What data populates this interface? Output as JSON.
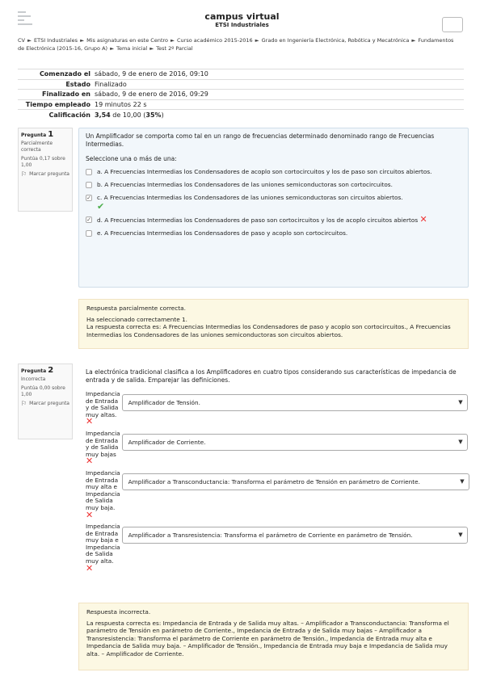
{
  "header": {
    "site_title": "campus virtual",
    "site_subtitle": "ETSI Industriales"
  },
  "breadcrumb": [
    "CV",
    "ETSI Industriales",
    "Mis asignaturas en este Centro",
    "Curso académico 2015-2016",
    "Grado en Ingeniería Electrónica, Robótica y Mecatrónica",
    "Fundamentos de Electrónica (2015-16, Grupo A)",
    "Tema inicial",
    "Test 2º Parcial"
  ],
  "summary": {
    "rows": [
      {
        "label": "Comenzado el",
        "value": "sábado, 9 de enero de 2016, 09:10"
      },
      {
        "label": "Estado",
        "value": "Finalizado"
      },
      {
        "label": "Finalizado en",
        "value": "sábado, 9 de enero de 2016, 09:29"
      },
      {
        "label": "Tiempo empleado",
        "value": "19 minutos 22 s"
      }
    ],
    "grade_label": "Calificación",
    "grade_score": "3,54",
    "grade_mid": " de 10,00 (",
    "grade_pct": "35%",
    "grade_end": ")"
  },
  "q1": {
    "label": "Pregunta",
    "number": "1",
    "state": "Parcialmente correcta",
    "grade": "Puntúa 0,17 sobre 1,00",
    "flag": "Marcar pregunta",
    "text": "Un Amplificador se comporta como tal en un rango de frecuencias determinado denominado rango de Frecuencias Intermedias.",
    "prompt": "Seleccione una o más de una:",
    "answers": [
      {
        "letter": "a.",
        "text": "A Frecuencias Intermedias los Condensadores de acoplo son cortocircuitos y los de paso son circuitos abiertos.",
        "checked": false,
        "mark": ""
      },
      {
        "letter": "b.",
        "text": "A Frecuencias Intermedias los Condensadores de las uniones semiconductoras son cortocircuitos.",
        "checked": false,
        "mark": ""
      },
      {
        "letter": "c.",
        "text": "A Frecuencias Intermedias los Condensadores de las uniones semiconductoras son circuitos abiertos.",
        "checked": true,
        "mark": "correct"
      },
      {
        "letter": "d.",
        "text": "A Frecuencias Intermedias los Condensadores de paso son cortocircuitos y los de acoplo circuitos abiertos",
        "checked": true,
        "mark": "incorrect"
      },
      {
        "letter": "e.",
        "text": "A Frecuencias Intermedias los Condensadores de paso y acoplo son cortocircuitos.",
        "checked": false,
        "mark": ""
      }
    ],
    "feedback": {
      "status": "Respuesta parcialmente correcta.",
      "selected": "Ha seleccionado correctamente 1.",
      "correct": "La respuesta correcta es: A Frecuencias Intermedias los Condensadores de paso y acoplo son cortocircuitos., A Frecuencias Intermedias los Condensadores de las uniones semiconductoras son circuitos abiertos."
    }
  },
  "q2": {
    "label": "Pregunta",
    "number": "2",
    "state": "Incorrecta",
    "grade": "Puntúa 0,00 sobre 1,00",
    "flag": "Marcar pregunta",
    "text": "La electrónica tradicional clasifica a los Amplificadores en cuatro tipos considerando sus características de impedancia de entrada y de salida. Emparejar las definiciones.",
    "matches": [
      {
        "label": "Impedancia de Entrada y de Salida muy altas.",
        "selected": "Amplificador de Tensión."
      },
      {
        "label": "Impedancia de Entrada y de Salida muy bajas",
        "selected": "Amplificador de Corriente."
      },
      {
        "label": "Impedancia de Entrada muy alta e Impedancia de Salida muy baja.",
        "selected": "Amplificador a Transconductancia: Transforma el parámetro de Tensión en parámetro de Corriente."
      },
      {
        "label": "Impedancia de Entrada muy baja e Impedancia de Salida muy alta.",
        "selected": "Amplificador a Transresistencia: Transforma el parámetro de Corriente en parámetro de Tensión."
      }
    ],
    "feedback": {
      "status": "Respuesta incorrecta.",
      "correct": "La respuesta correcta es: Impedancia de Entrada y de Salida muy altas. – Amplificador a Transconductancia: Transforma el parámetro de Tensión en parámetro de Corriente., Impedancia de Entrada y de Salida muy bajas – Amplificador a Transresistencia: Transforma el parámetro de Corriente en parámetro de Tensión., Impedancia de Entrada muy alta e Impedancia de Salida muy baja. – Amplificador de Tensión., Impedancia de Entrada muy baja e Impedancia de Salida muy alta. – Amplificador de Corriente."
    }
  }
}
